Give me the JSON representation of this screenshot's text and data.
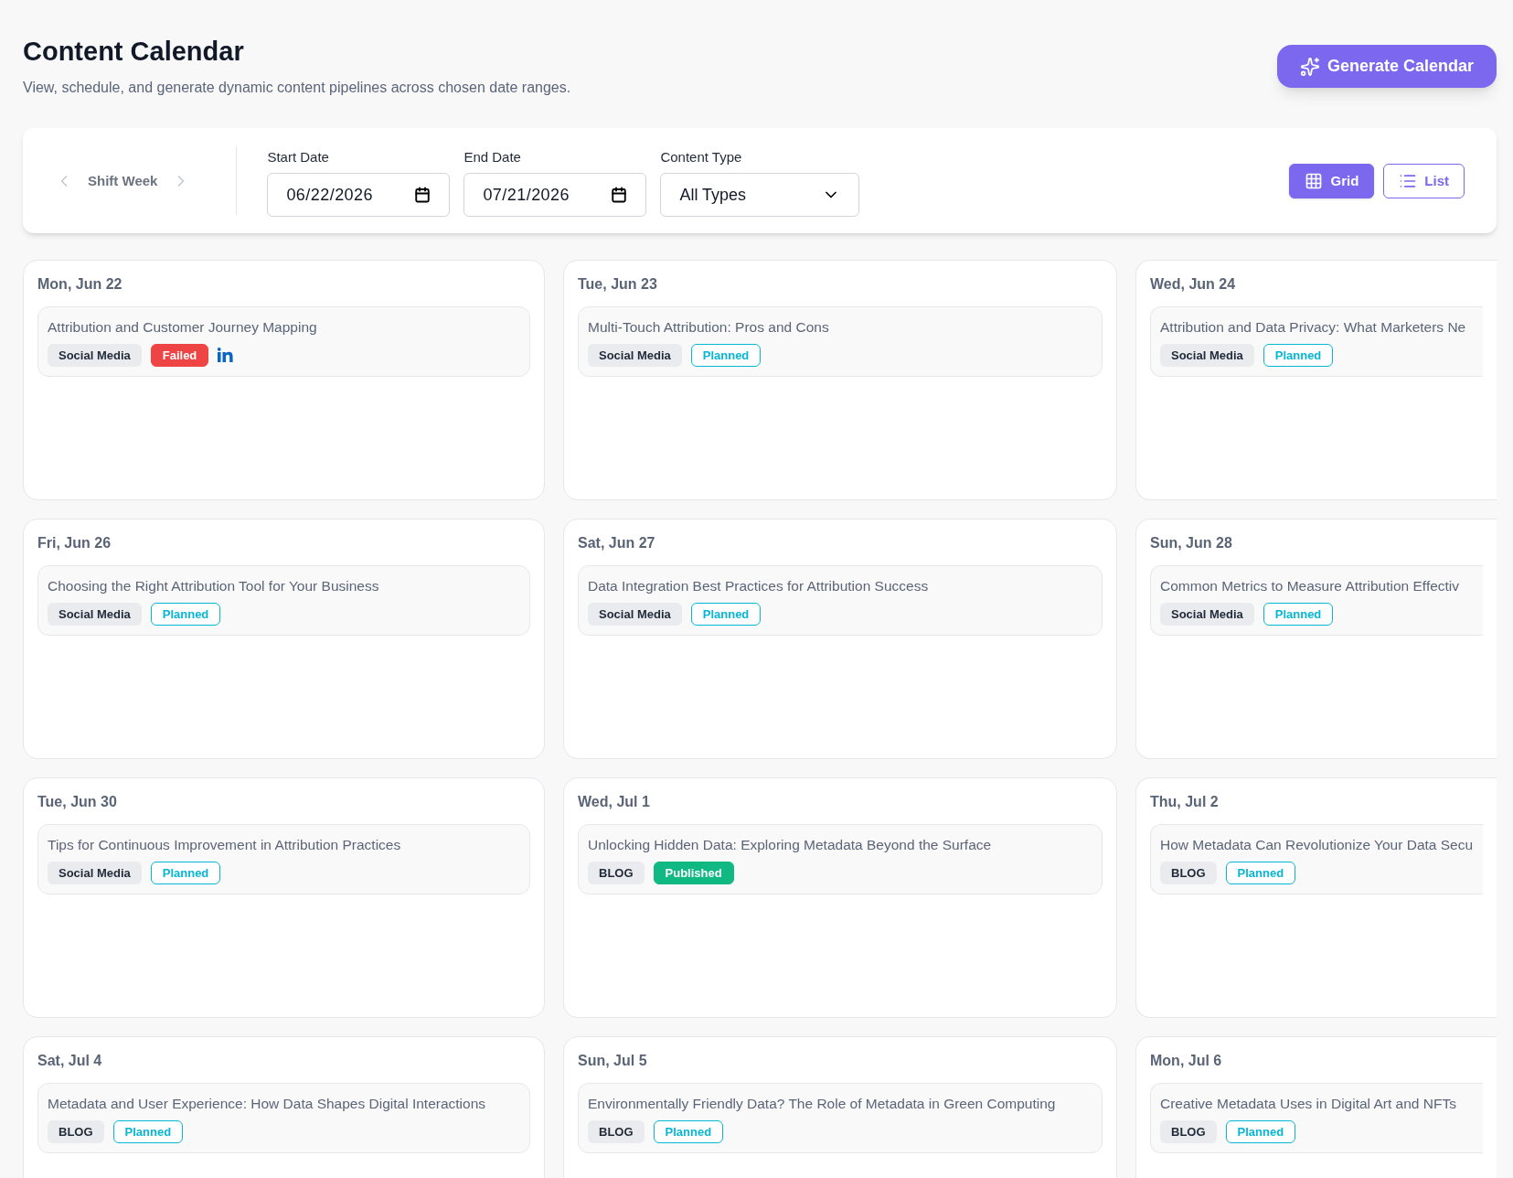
{
  "header": {
    "title": "Content Calendar",
    "subtitle": "View, schedule, and generate dynamic content pipelines across chosen date ranges.",
    "generate_button": "Generate Calendar"
  },
  "toolbar": {
    "shift_week": "Shift Week",
    "start_date": {
      "label": "Start Date",
      "value": "06/22/2026"
    },
    "end_date": {
      "label": "End Date",
      "value": "07/21/2026"
    },
    "content_type": {
      "label": "Content Type",
      "value": "All Types"
    },
    "views": [
      {
        "label": "Grid",
        "kind": "grid",
        "selected": true
      },
      {
        "label": "List",
        "kind": "list",
        "selected": false
      }
    ]
  },
  "days": [
    {
      "date": "Mon, Jun 22",
      "entries": [
        {
          "title": "Attribution and Customer Journey Mapping",
          "type": "Social Media",
          "status": "Failed",
          "kind": "failed",
          "linkedin": true
        }
      ]
    },
    {
      "date": "Tue, Jun 23",
      "entries": [
        {
          "title": "Multi-Touch Attribution: Pros and Cons",
          "type": "Social Media",
          "status": "Planned",
          "kind": "planned"
        }
      ]
    },
    {
      "date": "Wed, Jun 24",
      "entries": [
        {
          "title": "Attribution and Data Privacy: What Marketers Ne",
          "type": "Social Media",
          "status": "Planned",
          "kind": "planned"
        }
      ]
    },
    {
      "date": "Fri, Jun 26",
      "entries": [
        {
          "title": "Choosing the Right Attribution Tool for Your Business",
          "type": "Social Media",
          "status": "Planned",
          "kind": "planned"
        }
      ]
    },
    {
      "date": "Sat, Jun 27",
      "entries": [
        {
          "title": "Data Integration Best Practices for Attribution Success",
          "type": "Social Media",
          "status": "Planned",
          "kind": "planned"
        }
      ]
    },
    {
      "date": "Sun, Jun 28",
      "entries": [
        {
          "title": "Common Metrics to Measure Attribution Effectiv",
          "type": "Social Media",
          "status": "Planned",
          "kind": "planned"
        }
      ]
    },
    {
      "date": "Tue, Jun 30",
      "entries": [
        {
          "title": "Tips for Continuous Improvement in Attribution Practices",
          "type": "Social Media",
          "status": "Planned",
          "kind": "planned"
        }
      ]
    },
    {
      "date": "Wed, Jul 1",
      "entries": [
        {
          "title": "Unlocking Hidden Data: Exploring Metadata Beyond the Surface",
          "type": "BLOG",
          "status": "Published",
          "kind": "published"
        }
      ]
    },
    {
      "date": "Thu, Jul 2",
      "entries": [
        {
          "title": "How Metadata Can Revolutionize Your Data Secu",
          "type": "BLOG",
          "status": "Planned",
          "kind": "planned"
        }
      ]
    },
    {
      "date": "Sat, Jul 4",
      "entries": [
        {
          "title": "Metadata and User Experience: How Data Shapes Digital Interactions",
          "type": "BLOG",
          "status": "Planned",
          "kind": "planned"
        }
      ]
    },
    {
      "date": "Sun, Jul 5",
      "entries": [
        {
          "title": "Environmentally Friendly Data? The Role of Metadata in Green Computing",
          "type": "BLOG",
          "status": "Planned",
          "kind": "planned"
        }
      ]
    },
    {
      "date": "Mon, Jul 6",
      "entries": [
        {
          "title": "Creative Metadata Uses in Digital Art and NFTs",
          "type": "BLOG",
          "status": "Planned",
          "kind": "planned"
        }
      ]
    }
  ]
}
